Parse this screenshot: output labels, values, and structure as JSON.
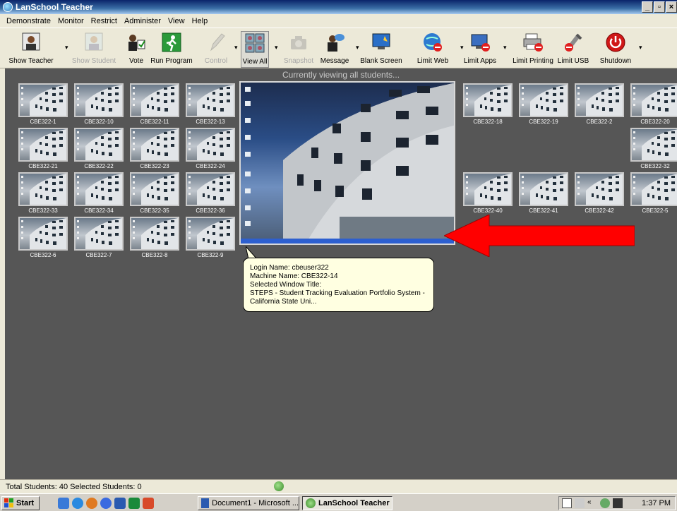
{
  "window": {
    "title": "LanSchool Teacher"
  },
  "menu": [
    "Demonstrate",
    "Monitor",
    "Restrict",
    "Administer",
    "View",
    "Help"
  ],
  "toolbar": {
    "show_teacher": "Show Teacher",
    "show_student": "Show Student",
    "vote": "Vote",
    "run_program": "Run Program",
    "control": "Control",
    "view_all": "View All",
    "snapshot": "Snapshot",
    "message": "Message",
    "blank_screen": "Blank Screen",
    "limit_web": "Limit Web",
    "limit_apps": "Limit Apps",
    "limit_printing": "Limit Printing",
    "limit_usb": "Limit USB",
    "shutdown": "Shutdown"
  },
  "main": {
    "viewing_text": "Currently viewing all students...",
    "students": [
      "CBE322-1",
      "CBE322-10",
      "CBE322-11",
      "CBE322-13",
      "CBE322-18",
      "CBE322-19",
      "CBE322-2",
      "CBE322-20",
      "CBE322-21",
      "CBE322-22",
      "CBE322-23",
      "CBE322-24",
      "CBE322-32",
      "CBE322-33",
      "CBE322-34",
      "CBE322-35",
      "CBE322-36",
      "CBE322-40",
      "CBE322-41",
      "CBE322-42",
      "CBE322-5",
      "CBE322-6",
      "CBE322-7",
      "CBE322-8",
      "CBE322-9"
    ],
    "tooltip": {
      "login": "Login Name: cbeuser322",
      "machine": "Machine Name: CBE322-14",
      "window_label": "Selected Window Title:",
      "window_title_1": "STEPS - Student Tracking Evaluation Portfolio System -",
      "window_title_2": "California State Uni..."
    }
  },
  "status": {
    "text": "Total Students: 40  Selected Students: 0"
  },
  "taskbar": {
    "start": "start",
    "task1": "Document1 - Microsoft ...",
    "task2": "LanSchool Teacher",
    "clock": "1:37 PM"
  },
  "colors": {
    "accent": "#ff0000",
    "background": "#565656",
    "tooltip_bg": "#ffffe1"
  }
}
